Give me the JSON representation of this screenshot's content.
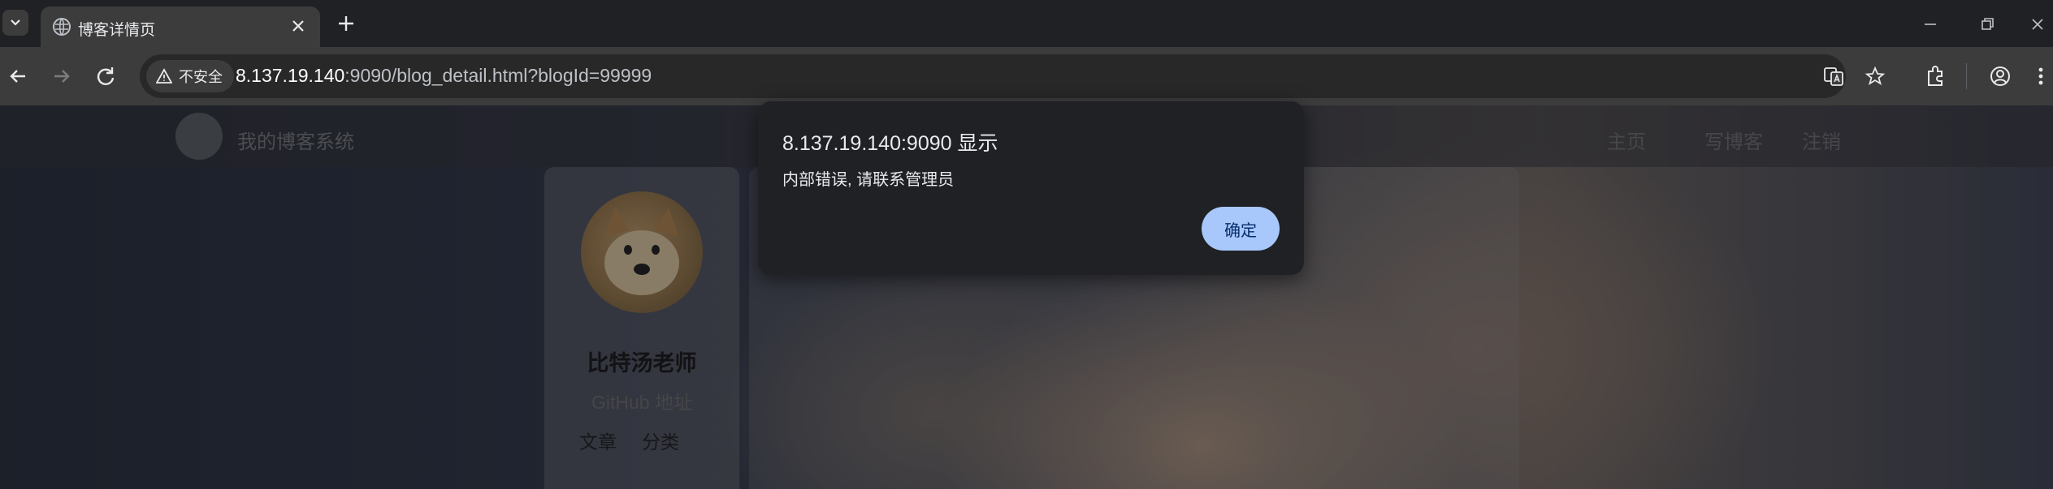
{
  "browser": {
    "tab": {
      "title": "博客详情页"
    },
    "address": {
      "security_label": "不安全",
      "host": "8.137.19.140",
      "rest": ":9090/blog_detail.html?blogId=99999"
    }
  },
  "site": {
    "name": "我的博客系统",
    "nav": [
      "主页",
      "写博客",
      "注销"
    ]
  },
  "profile": {
    "author": "比特汤老师",
    "github": "GitHub 地址",
    "stats": [
      "文章",
      "分类"
    ]
  },
  "dialog": {
    "title": "8.137.19.140:9090 显示",
    "message": "内部错误, 请联系管理员",
    "ok": "确定"
  },
  "colors": {
    "accent": "#a8c7fa",
    "dialog_bg": "#202124",
    "toolbar_bg": "#3c3c3c"
  }
}
